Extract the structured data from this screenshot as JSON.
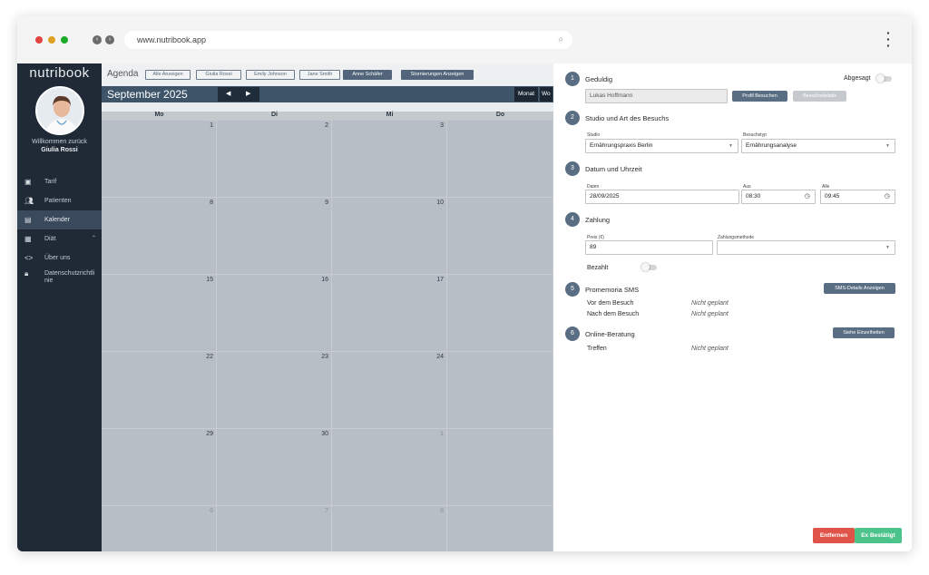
{
  "browser": {
    "url": "www.nutribook.app",
    "dot_colors": [
      "#e0443e",
      "#dea123",
      "#1aab29"
    ]
  },
  "sidebar": {
    "logo": "nutribook",
    "welcome": "Willkommen zurück",
    "user_name": "Giulia Rossi",
    "items": [
      {
        "label": "Tarif",
        "icon": "tariff-icon"
      },
      {
        "label": "Patienten",
        "icon": "patients-icon"
      },
      {
        "label": "Kalender",
        "icon": "calendar-icon",
        "active": true
      },
      {
        "label": "Diät",
        "icon": "diet-icon"
      },
      {
        "label": "Über uns",
        "icon": "code-icon"
      },
      {
        "label": "Datenschutzrichtlinie",
        "icon": "lock-icon"
      }
    ]
  },
  "agenda": {
    "title": "Agenda",
    "filters": [
      "Alle Anzeigen",
      "Giulia Rossi",
      "Emily Johnson",
      "Jane Smith",
      "Anne Schäfer"
    ],
    "selected_filter": "Anne Schäfer",
    "cancellations_button": "Stornierungen Anzeigen",
    "month": "September 2025",
    "views": [
      "Monat",
      "Wo"
    ],
    "weekday_headers": [
      "Mo",
      "Di",
      "Mi",
      "Do"
    ],
    "weeks": [
      [
        "1",
        "2",
        "3",
        ""
      ],
      [
        "8",
        "9",
        "10",
        ""
      ],
      [
        "15",
        "16",
        "17",
        ""
      ],
      [
        "22",
        "23",
        "24",
        ""
      ],
      [
        "29",
        "30",
        "1",
        ""
      ],
      [
        "6",
        "7",
        "8",
        ""
      ]
    ]
  },
  "panel": {
    "steps": [
      {
        "number": "1",
        "title": "Geduldig"
      },
      {
        "number": "2",
        "title": "Studio und Art des Besuchs"
      },
      {
        "number": "3",
        "title": "Datum und Uhrzeit"
      },
      {
        "number": "4",
        "title": "Zahlung"
      },
      {
        "number": "5",
        "title": "Promemoria SMS"
      },
      {
        "number": "6",
        "title": "Online-Beratung"
      }
    ],
    "cancelled_label": "Abgesagt",
    "patient_name": "Lukas Hoffmann",
    "profile_button": "Profil Besuchen",
    "visit_details_button": "Besuchsdetails",
    "studio_label": "Studio",
    "studio_value": "Ernährungspraxis Berlin",
    "visit_type_label": "Besuchstyp",
    "visit_type_value": "Ernährungsanalyse",
    "date_label": "Daten",
    "date_value": "28/09/2025",
    "from_label": "Aus",
    "from_value": "08:30",
    "to_label": "Alle",
    "to_value": "09:45",
    "price_label": "Preis (€)",
    "price_value": "89",
    "payment_method_label": "Zahlungsmethode",
    "payment_method_value": "",
    "paid_label": "Bezahlt",
    "sms_button": "SMS-Details Anzeigen",
    "sms_before_label": "Vor dem Besuch",
    "sms_before_value": "Nicht geplant",
    "sms_after_label": "Nach dem Besuch",
    "sms_after_value": "Nicht geplant",
    "online_button": "Siehe Einzelheiten",
    "meeting_label": "Treffen",
    "meeting_value": "Nicht geplant",
    "remove_button": "Entfernen",
    "confirm_button": "Ex Bestätigt",
    "colors": {
      "remove": "#e05348",
      "confirm": "#4cc38a",
      "step": "#5a6e83"
    }
  }
}
